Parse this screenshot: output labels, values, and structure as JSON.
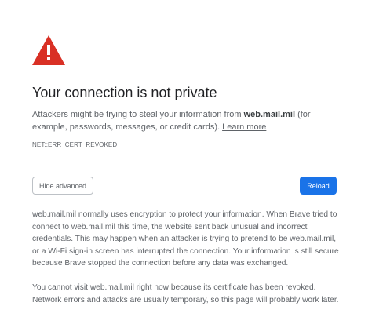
{
  "icon": {
    "name": "warning-triangle-icon",
    "color": "#d93025",
    "symbol": "!"
  },
  "title": "Your connection is not private",
  "main_message": {
    "prefix": "Attackers might be trying to steal your information from ",
    "site": "web.mail.mil",
    "suffix": " (for example, passwords, messages, or credit cards). ",
    "learn_more": "Learn more"
  },
  "error_code": "NET::ERR_CERT_REVOKED",
  "buttons": {
    "hide_advanced": "Hide advanced",
    "reload": "Reload",
    "reload_color": "#1a73e8"
  },
  "details": {
    "paragraph1": "web.mail.mil normally uses encryption to protect your information. When Brave tried to connect to web.mail.mil this time, the website sent back unusual and incorrect credentials. This may happen when an attacker is trying to pretend to be web.mail.mil, or a Wi-Fi sign-in screen has interrupted the connection. Your information is still secure because Brave stopped the connection before any data was exchanged.",
    "paragraph2": "You cannot visit web.mail.mil right now because its certificate has been revoked. Network errors and attacks are usually temporary, so this page will probably work later."
  }
}
